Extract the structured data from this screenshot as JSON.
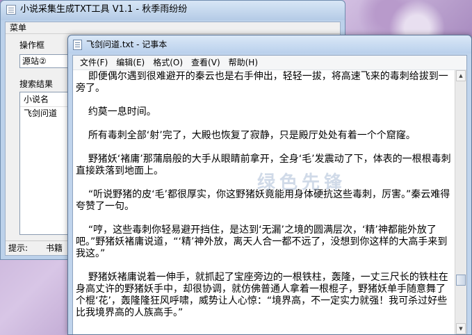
{
  "app": {
    "title": "小说采集生成TXT工具 V1.1 - 秋季雨纷纷",
    "menu": "菜单",
    "operation_box_label": "操作框",
    "source_select_value": "源站②",
    "search_results_label": "搜索结果",
    "results_header": "小说名",
    "results_items": [
      "飞剑问道"
    ],
    "status_hint_label": "提示:",
    "status_bookmark_label": "书籍"
  },
  "notepad": {
    "title": "飞剑问道.txt - 记事本",
    "menu": [
      "文件(F)",
      "编辑(E)",
      "格式(O)",
      "查看(V)",
      "帮助(H)"
    ],
    "lines": [
      "    即便偶尔遇到很难避开的秦云也是右手伸出，轻轻一拔，将高速飞来的毒刺给拔到一旁了。",
      "",
      "    约莫一息时间。",
      "",
      "    所有毒刺全部‘射’完了，大殿也恢复了寂静，只是殿厅处处有着一个个窟窿。",
      "",
      "    野猪妖‘褚庸’那蒲扇般的大手从眼睛前拿开，全身‘毛’发震动了下，体表的一根根毒刺直接跌落到地面上。",
      "",
      "    “听说野猪的皮‘毛’都很厚实，你这野猪妖竟能用身体硬抗这些毒刺，厉害。”秦云难得夸赞了一句。",
      "",
      "    “哼，这些毒刺你轻易避开挡住，是达到‘无漏’之境的圆满层次，‘精’神都能外放了吧。”野猪妖褚庸说道，“‘精’神外放，离天人合一都不远了，没想到你这样的大高手来到我这。”",
      "",
      "    野猪妖褚庸说着一伸手，就抓起了宝座旁边的一根铁柱，轰隆，一丈三尺长的铁柱在身高丈许的野猪妖手中，却很协调，就仿佛普通人拿着一根棍子，野猪妖单手随意舞了个棍‘花’，轰隆隆狂风呼啸，威势让人心惊：“境界高，不一定实力就强！我可杀过好些比我境界高的人族高手。”"
    ],
    "watermark": "绿色先锋"
  },
  "icons": {
    "app_icon": "window-app-icon",
    "notepad_icon": "notepad-icon",
    "scroll_up": "scroll-up-arrow-icon",
    "scroll_down": "scroll-down-arrow-icon"
  }
}
